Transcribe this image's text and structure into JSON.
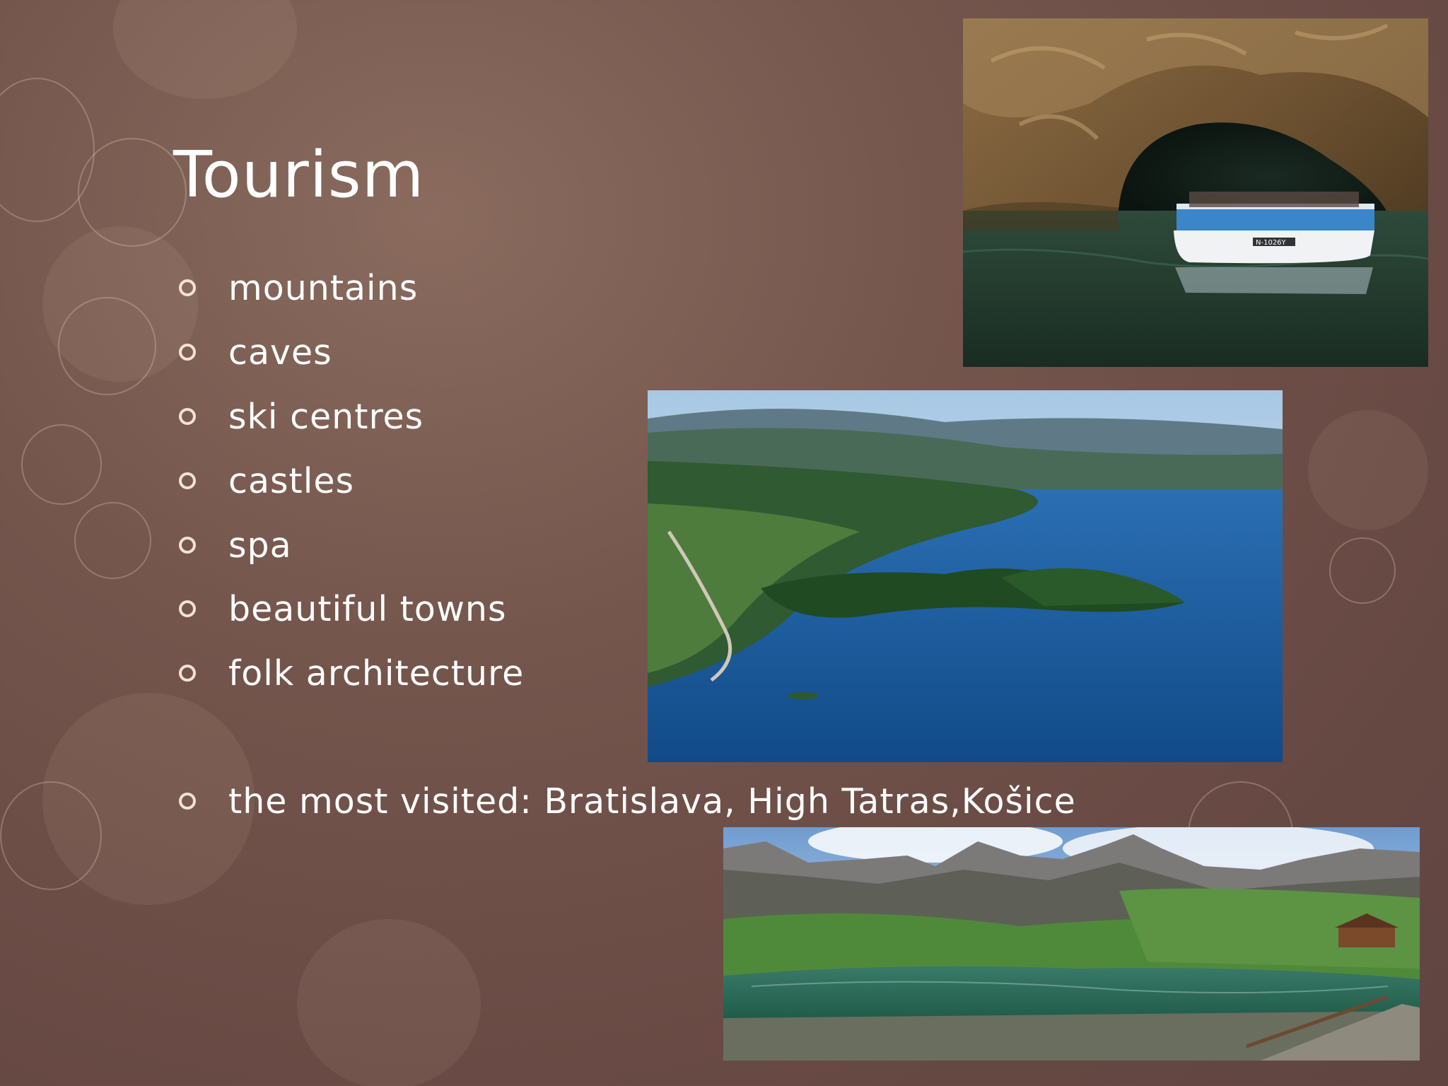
{
  "slide": {
    "title": "Tourism",
    "bullets": [
      "mountains",
      "caves",
      "ski centres",
      "castles",
      "spa",
      "beautiful towns",
      "folk architecture",
      "the most visited: Bratislava, High Tatras,Košice"
    ],
    "photos": [
      {
        "name": "cave-boat-photo",
        "boat_label": "N-1026Y"
      },
      {
        "name": "lake-aerial-photo"
      },
      {
        "name": "mountain-lake-photo"
      }
    ]
  },
  "colors": {
    "background": "#6f524a",
    "text": "#ffffff",
    "bullet_marker": "#f1e3d3"
  }
}
